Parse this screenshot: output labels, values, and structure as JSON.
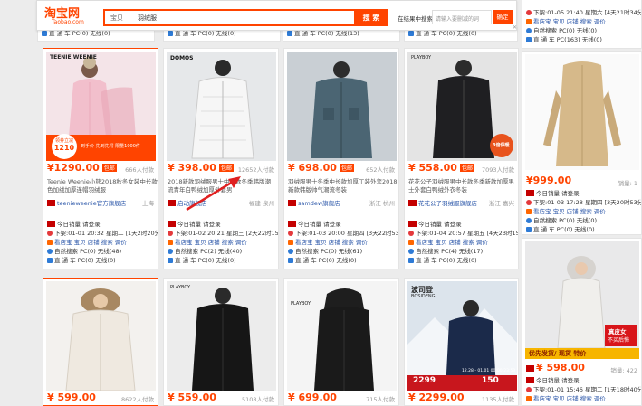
{
  "header": {
    "logo": "淘宝网",
    "logo_sub": "Taobao.com",
    "category": "宝贝",
    "query": "羽绒服",
    "search_btn": "搜 索",
    "refine_label": "在结果中搜索",
    "refine_placeholder": "请输入要删减的词",
    "refine_btn": "确定"
  },
  "top_strip": {
    "c1": "直 通 车 PC(0) 无线(0)",
    "c2": "直 通 车 PC(0) 无线(0)",
    "c3": "直 通 车 PC(0) 无线(13)",
    "c4": "直 通 车 PC(0) 无线(0)"
  },
  "right_top": {
    "l1": "下架:01-05 21:40 星期六 [4天21时34分]",
    "l2": "看店宝 宝贝 店铺 搜索 调价",
    "l3": "自然搜索 PC(0) 无线(0)",
    "l4": "直 通 车 PC(163) 无线(0)"
  },
  "row1": [
    {
      "price": "¥1290.00",
      "tag": "包邮",
      "paid": "666人付款",
      "title1": "Teenie Weenie小熊2018秋冬女装中长款韩",
      "title2": "色加绒加厚连帽羽绒服",
      "shop": "teenieweenie官方旗舰店",
      "loc": "上海",
      "sales": "今日销量 请登录",
      "l1": "下架:01-01 20:32 星期二 [1天2时20分]",
      "l2": "看店宝 宝贝 店铺 搜索 调价",
      "l3": "自然搜索 PC(0) 无线(48)",
      "l4": "直 通 车 PC(0) 无线(0)",
      "img_brand": "TEENIE WEENIE",
      "badge_top": "领券立减",
      "badge_price": "1210",
      "badge_sub": "到手价 先到先得 限量1000件"
    },
    {
      "price": "¥ 398.00",
      "tag": "包邮",
      "paid": "12652人付款",
      "title1": "2018新款羽绒服男士中长款冬季韩版潮",
      "title2": "流青年白鸭绒加厚外套男",
      "shop": "启动旗舰店",
      "loc": "福建 泉州",
      "sales": "今日销量 请登录",
      "l1": "下架:01-02 20:21 星期三 [2天22时15分]",
      "l2": "看店宝 宝贝 店铺 搜索 调价",
      "l3": "自然搜索 PC(2) 无线(40)",
      "l4": "直 通 车 PC(0) 无线(0)",
      "img_brand": "DOMOS"
    },
    {
      "price": "¥ 698.00",
      "tag": "包邮",
      "paid": "652人付款",
      "title1": "羽绒服男士冬季中长款加厚工装外套2018",
      "title2": "新款韩版帅气潮流冬装",
      "shop": "samdew旗舰店",
      "loc": "浙江 杭州",
      "sales": "今日销量 请登录",
      "l1": "下架:01-03 20:00 星期四 [3天22时53分]",
      "l2": "看店宝 宝贝 店铺 搜索 调价",
      "l3": "自然搜索 PC(0) 无线(61)",
      "l4": "直 通 车 PC(0) 无线(0)"
    },
    {
      "price": "¥ 558.00",
      "tag": "包邮",
      "paid": "7093人付款",
      "title1": "花花公子羽绒服男中长款冬季新款加厚男",
      "title2": "士外套白鸭绒外衣冬装",
      "shop": "花花公子羽绒服旗舰店",
      "loc": "浙江 嘉兴",
      "sales": "今日销量 请登录",
      "l1": "下架:01-04 20:57 星期五 [4天23时15分]",
      "l2": "看店宝 宝贝 店铺 搜索 调价",
      "l3": "自然搜索 PC(4) 无线(17)",
      "l4": "直 通 车 PC(0) 无线(0)",
      "img_brand": "PLAYBOY",
      "badge_label": "3倍保暖"
    }
  ],
  "right_mid": {
    "price": "¥999.00",
    "paid": "销量: 1",
    "l1": "下架:01-03 17:28 星期四 [3天20时53分]",
    "l2": "看店宝 宝贝 店铺 搜索 调价",
    "l3": "自然搜索 PC(0) 无线(0)",
    "l4": "直 通 车 PC(0) 无线(0)"
  },
  "row2": [
    {
      "price": "¥ 599.00",
      "paid": "8622人付款"
    },
    {
      "price": "¥ 559.00",
      "paid": "5108人付款",
      "img_brand": "PLAYBOY"
    },
    {
      "price": "¥ 699.00",
      "paid": "715人付款",
      "img_brand": "PLAYBOY"
    },
    {
      "price": "¥ 2299.00",
      "paid": "1135人付款",
      "img_brand": "波司登",
      "img_sub": "BOSIDENG",
      "img_promo": "2299",
      "img_promo2": "150",
      "img_date": "12.28 - 01.01 00:00-23:59"
    }
  ],
  "right_bottom": {
    "promo1": "真皮女",
    "promo2": "不买后悔",
    "banner": "优先发货/ 现货 特价",
    "price": "¥ 598.00",
    "paid": "销量: 422",
    "l1": "下架:01-01 15:46 星期二 [1天18时40分]",
    "l2": "看店宝 宝贝 店铺 搜索 调价"
  },
  "colors": {
    "accent": "#ff4400",
    "link": "#2955a8",
    "annotation_arrow": "#e02020"
  }
}
